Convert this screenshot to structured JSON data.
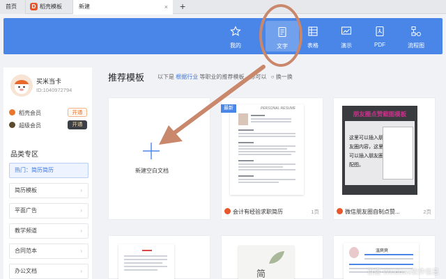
{
  "tabs": {
    "home": "首页",
    "dao_template": "稻壳模板",
    "new": "新建",
    "close": "×",
    "add": "+"
  },
  "nav": [
    {
      "label": "我的",
      "icon": "star-icon"
    },
    {
      "label": "文字",
      "icon": "document-icon"
    },
    {
      "label": "表格",
      "icon": "table-icon"
    },
    {
      "label": "演示",
      "icon": "presentation-icon"
    },
    {
      "label": "PDF",
      "icon": "pdf-icon"
    },
    {
      "label": "流程图",
      "icon": "flowchart-icon"
    }
  ],
  "user": {
    "name": "买米当卡",
    "id": "ID:1040972794",
    "members": [
      {
        "label": "稻壳会员",
        "button": "开通"
      },
      {
        "label": "超级会员",
        "button": "开通"
      }
    ]
  },
  "categories": {
    "title": "品类专区",
    "items": [
      "热门：简历简历",
      "简历模板",
      "平面广告",
      "教学频道",
      "合同范本",
      "办公文档"
    ]
  },
  "main": {
    "title": "推荐模板",
    "subtitle_prefix": "以下是",
    "subtitle_link": "根据行业",
    "subtitle_suffix": "等职业的推荐模板，你可以",
    "refresh": "换一换",
    "blank_label": "新建空白文档",
    "new_badge": "最新",
    "cards": [
      {
        "title": "会计有经验求职简历",
        "pages": "1页"
      },
      {
        "title": "微信朋友圈自制点赞...",
        "pages": "2页"
      }
    ],
    "wechat_thumb_title": "朋友圈点赞截图模板",
    "wechat_thumb_text": [
      "这里可以插入朋",
      "友圈内容，这里",
      "可以插入朋友圈",
      "配图。"
    ],
    "resume_thumb_header": "PERSONAL RESUME",
    "third_row_title": "简",
    "third_row_name": "温爽爽"
  },
  "watermark": "百度 Windows软件信息",
  "colors": {
    "accent": "#4a86e8",
    "brand": "#e8572c",
    "highlight": "#c9876b"
  }
}
